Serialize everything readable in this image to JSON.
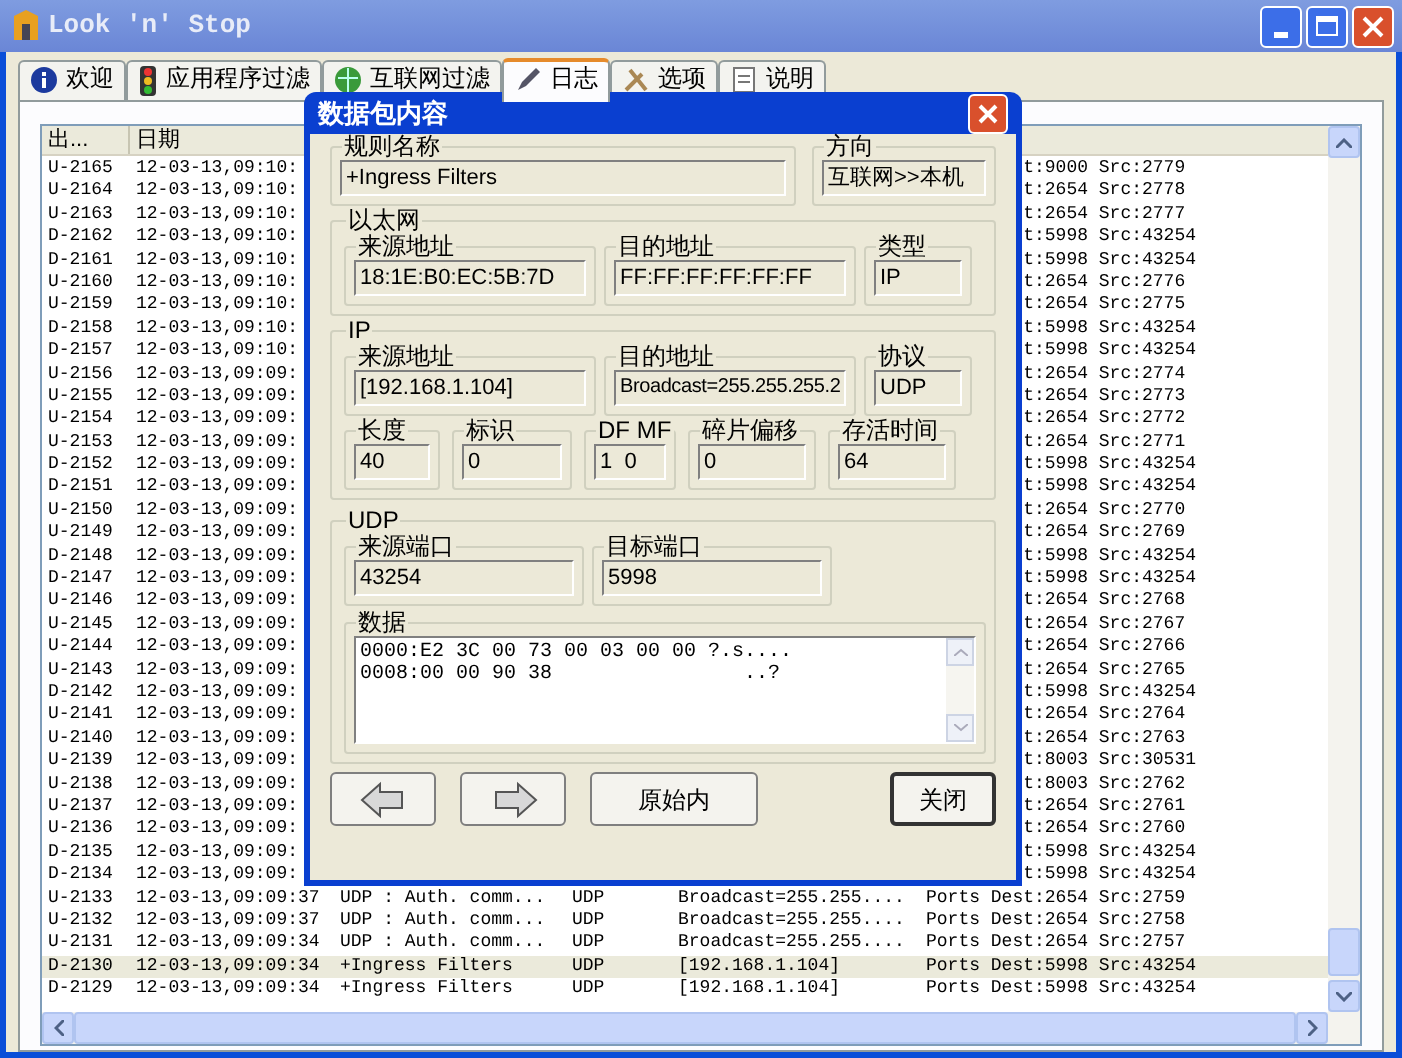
{
  "window": {
    "title": "Look 'n' Stop"
  },
  "tabs": [
    {
      "label": "欢迎",
      "selected": false
    },
    {
      "label": "应用程序过滤",
      "selected": false
    },
    {
      "label": "互联网过滤",
      "selected": false
    },
    {
      "label": "日志",
      "selected": true
    },
    {
      "label": "选项",
      "selected": false
    },
    {
      "label": "说明",
      "selected": false
    }
  ],
  "log": {
    "columns": [
      "出...",
      "日期"
    ],
    "rows": [
      {
        "kind": "covered",
        "id": "U-2165",
        "date": "12-03-13,09:10:",
        "ports": "t:9000 Src:2779",
        "selected": false
      },
      {
        "kind": "covered",
        "id": "U-2164",
        "date": "12-03-13,09:10:",
        "ports": "t:2654 Src:2778",
        "selected": false
      },
      {
        "kind": "covered",
        "id": "U-2163",
        "date": "12-03-13,09:10:",
        "ports": "t:2654 Src:2777",
        "selected": false
      },
      {
        "kind": "covered",
        "id": "D-2162",
        "date": "12-03-13,09:10:",
        "ports": "t:5998 Src:43254",
        "selected": false
      },
      {
        "kind": "covered",
        "id": "D-2161",
        "date": "12-03-13,09:10:",
        "ports": "t:5998 Src:43254",
        "selected": false
      },
      {
        "kind": "covered",
        "id": "U-2160",
        "date": "12-03-13,09:10:",
        "ports": "t:2654 Src:2776",
        "selected": false
      },
      {
        "kind": "covered",
        "id": "U-2159",
        "date": "12-03-13,09:10:",
        "ports": "t:2654 Src:2775",
        "selected": false
      },
      {
        "kind": "covered",
        "id": "D-2158",
        "date": "12-03-13,09:10:",
        "ports": "t:5998 Src:43254",
        "selected": false
      },
      {
        "kind": "covered",
        "id": "D-2157",
        "date": "12-03-13,09:10:",
        "ports": "t:5998 Src:43254",
        "selected": false
      },
      {
        "kind": "covered",
        "id": "U-2156",
        "date": "12-03-13,09:09:",
        "ports": "t:2654 Src:2774",
        "selected": false
      },
      {
        "kind": "covered",
        "id": "U-2155",
        "date": "12-03-13,09:09:",
        "ports": "t:2654 Src:2773",
        "selected": false
      },
      {
        "kind": "covered",
        "id": "U-2154",
        "date": "12-03-13,09:09:",
        "ports": "t:2654 Src:2772",
        "selected": false
      },
      {
        "kind": "covered",
        "id": "U-2153",
        "date": "12-03-13,09:09:",
        "ports": "t:2654 Src:2771",
        "selected": false
      },
      {
        "kind": "covered",
        "id": "D-2152",
        "date": "12-03-13,09:09:",
        "ports": "t:5998 Src:43254",
        "selected": false
      },
      {
        "kind": "covered",
        "id": "D-2151",
        "date": "12-03-13,09:09:",
        "ports": "t:5998 Src:43254",
        "selected": false
      },
      {
        "kind": "covered",
        "id": "U-2150",
        "date": "12-03-13,09:09:",
        "ports": "t:2654 Src:2770",
        "selected": false
      },
      {
        "kind": "covered",
        "id": "U-2149",
        "date": "12-03-13,09:09:",
        "ports": "t:2654 Src:2769",
        "selected": false
      },
      {
        "kind": "covered",
        "id": "D-2148",
        "date": "12-03-13,09:09:",
        "ports": "t:5998 Src:43254",
        "selected": false
      },
      {
        "kind": "covered",
        "id": "D-2147",
        "date": "12-03-13,09:09:",
        "ports": "t:5998 Src:43254",
        "selected": false
      },
      {
        "kind": "covered",
        "id": "U-2146",
        "date": "12-03-13,09:09:",
        "ports": "t:2654 Src:2768",
        "selected": false
      },
      {
        "kind": "covered",
        "id": "U-2145",
        "date": "12-03-13,09:09:",
        "ports": "t:2654 Src:2767",
        "selected": false
      },
      {
        "kind": "covered",
        "id": "U-2144",
        "date": "12-03-13,09:09:",
        "ports": "t:2654 Src:2766",
        "selected": false
      },
      {
        "kind": "covered",
        "id": "U-2143",
        "date": "12-03-13,09:09:",
        "ports": "t:2654 Src:2765",
        "selected": false
      },
      {
        "kind": "covered",
        "id": "D-2142",
        "date": "12-03-13,09:09:",
        "ports": "t:5998 Src:43254",
        "selected": false
      },
      {
        "kind": "covered",
        "id": "U-2141",
        "date": "12-03-13,09:09:",
        "ports": "t:2654 Src:2764",
        "selected": false
      },
      {
        "kind": "covered",
        "id": "U-2140",
        "date": "12-03-13,09:09:",
        "ports": "t:2654 Src:2763",
        "selected": false
      },
      {
        "kind": "covered",
        "id": "U-2139",
        "date": "12-03-13,09:09:",
        "ports": "t:8003 Src:30531",
        "selected": false
      },
      {
        "kind": "covered",
        "id": "U-2138",
        "date": "12-03-13,09:09:",
        "ports": "t:8003 Src:2762",
        "selected": false
      },
      {
        "kind": "covered",
        "id": "U-2137",
        "date": "12-03-13,09:09:",
        "ports": "t:2654 Src:2761",
        "selected": false
      },
      {
        "kind": "covered",
        "id": "U-2136",
        "date": "12-03-13,09:09:",
        "ports": "t:2654 Src:2760",
        "selected": false
      },
      {
        "kind": "covered",
        "id": "D-2135",
        "date": "12-03-13,09:09:",
        "ports": "t:5998 Src:43254",
        "selected": false
      },
      {
        "kind": "covered",
        "id": "D-2134",
        "date": "12-03-13,09:09:",
        "ports": "t:5998 Src:43254",
        "selected": false
      },
      {
        "kind": "full",
        "id": "U-2133",
        "date": "12-03-13,09:09:37",
        "rule": "UDP : Auth. comm...",
        "proto": "UDP",
        "dest": "Broadcast=255.255....",
        "ports": "Ports Dest:2654 Src:2759",
        "selected": false
      },
      {
        "kind": "full",
        "id": "U-2132",
        "date": "12-03-13,09:09:37",
        "rule": "UDP : Auth. comm...",
        "proto": "UDP",
        "dest": "Broadcast=255.255....",
        "ports": "Ports Dest:2654 Src:2758",
        "selected": false
      },
      {
        "kind": "full",
        "id": "U-2131",
        "date": "12-03-13,09:09:34",
        "rule": "UDP : Auth. comm...",
        "proto": "UDP",
        "dest": "Broadcast=255.255....",
        "ports": "Ports Dest:2654 Src:2757",
        "selected": false
      },
      {
        "kind": "full",
        "id": "D-2130",
        "date": "12-03-13,09:09:34",
        "rule": "+Ingress Filters",
        "proto": "UDP",
        "dest": "[192.168.1.104]",
        "ports": "Ports Dest:5998 Src:43254",
        "selected": true
      },
      {
        "kind": "full",
        "id": "D-2129",
        "date": "12-03-13,09:09:34",
        "rule": "+Ingress Filters",
        "proto": "UDP",
        "dest": "[192.168.1.104]",
        "ports": "Ports Dest:5998 Src:43254",
        "selected": false
      }
    ]
  },
  "dialog": {
    "title": "数据包内容",
    "rule": {
      "label": "规则名称",
      "value": "+Ingress Filters"
    },
    "direction": {
      "label": "方向",
      "value": "互联网>>本机"
    },
    "ethernet": {
      "label": "以太网",
      "fields": [
        {
          "label": "来源地址",
          "value": "18:1E:B0:EC:5B:7D"
        },
        {
          "label": "目的地址",
          "value": "FF:FF:FF:FF:FF:FF"
        },
        {
          "label": "类型",
          "value": "IP"
        }
      ]
    },
    "ip": {
      "label": "IP",
      "fields": [
        {
          "label": "来源地址",
          "value": "[192.168.1.104]"
        },
        {
          "label": "目的地址",
          "value": "Broadcast=255.255.255.2"
        },
        {
          "label": "协议",
          "value": "UDP"
        }
      ],
      "fields2": [
        {
          "label": "长度",
          "value": "40"
        },
        {
          "label": "标识",
          "value": "0"
        },
        {
          "label": "DF MF",
          "value": "1  0"
        },
        {
          "label": "碎片偏移",
          "value": "0"
        },
        {
          "label": "存活时间",
          "value": "64"
        }
      ]
    },
    "udp": {
      "label": "UDP",
      "fields": [
        {
          "label": "来源端口",
          "value": "43254"
        },
        {
          "label": "目标端口",
          "value": "5998"
        }
      ],
      "data": {
        "label": "数据",
        "lines": [
          "0000:E2 3C 00 73 00 03 00 00 ?.s....",
          "0008:00 00 90 38                ..?"
        ]
      }
    },
    "buttons": [
      {
        "kind": "prev"
      },
      {
        "kind": "next"
      },
      {
        "kind": "text",
        "label": "原始内",
        "default": false
      },
      {
        "kind": "text",
        "label": "关闭",
        "default": true
      }
    ]
  }
}
